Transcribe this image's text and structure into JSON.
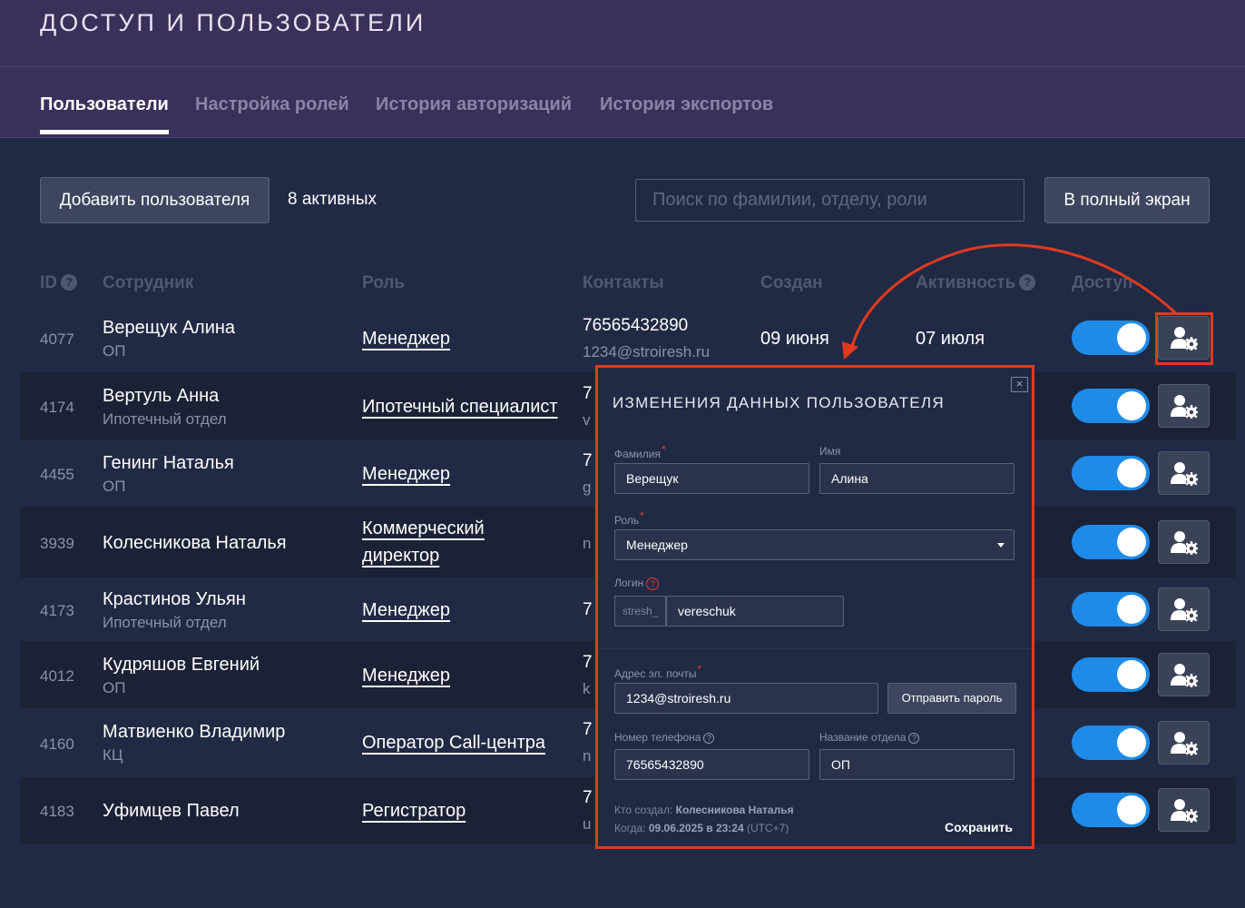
{
  "header": {
    "title": "ДОСТУП И ПОЛЬЗОВАТЕЛИ",
    "tabs": [
      {
        "label": "Пользователи",
        "active": true
      },
      {
        "label": "Настройка ролей",
        "active": false
      },
      {
        "label": "История авторизаций",
        "active": false
      },
      {
        "label": "История экспортов",
        "active": false
      }
    ]
  },
  "toolbar": {
    "add_user_label": "Добавить пользователя",
    "active_count": "8 активных",
    "search_placeholder": "Поиск по фамилии, отделу, роли",
    "fullscreen_label": "В полный экран"
  },
  "table": {
    "columns": {
      "id": "ID",
      "employee": "Сотрудник",
      "role": "Роль",
      "contacts": "Контакты",
      "created": "Создан",
      "activity": "Активность",
      "access": "Доступ"
    },
    "rows": [
      {
        "id": "4077",
        "name": "Верещук Алина",
        "dept": "ОП",
        "role": "Менеджер",
        "role2": "",
        "phone": "76565432890",
        "email": "1234@stroiresh.ru",
        "created": "09 июня",
        "activity": "07 июля",
        "access": true
      },
      {
        "id": "4174",
        "name": "Вертуль Анна",
        "dept": "Ипотечный отдел",
        "role": "Ипотечный специалист",
        "role2": "",
        "phone": "7",
        "email": "v",
        "created": "",
        "activity": "",
        "access": true
      },
      {
        "id": "4455",
        "name": "Генинг Наталья",
        "dept": "ОП",
        "role": "Менеджер",
        "role2": "",
        "phone": "7",
        "email": "g",
        "created": "",
        "activity": "",
        "access": true
      },
      {
        "id": "3939",
        "name": "Колесникова Наталья",
        "dept": "",
        "role": "Коммерческий",
        "role2": "директор",
        "phone": "",
        "email": "n",
        "created": "",
        "activity": "",
        "access": true
      },
      {
        "id": "4173",
        "name": "Крастинов Ульян",
        "dept": "Ипотечный отдел",
        "role": "Менеджер",
        "role2": "",
        "phone": "7",
        "email": "",
        "created": "",
        "activity": "",
        "access": true
      },
      {
        "id": "4012",
        "name": "Кудряшов Евгений",
        "dept": "ОП",
        "role": "Менеджер",
        "role2": "",
        "phone": "7",
        "email": "k",
        "created": "",
        "activity": "",
        "access": true
      },
      {
        "id": "4160",
        "name": "Матвиенко Владимир",
        "dept": "КЦ",
        "role": "Оператор Call-центра",
        "role2": "",
        "phone": "7",
        "email": "n",
        "created": "",
        "activity": "",
        "access": true
      },
      {
        "id": "4183",
        "name": "Уфимцев Павел",
        "dept": "",
        "role": "Регистратор",
        "role2": "",
        "phone": "7",
        "email": "u",
        "created": "",
        "activity": "",
        "access": true
      }
    ]
  },
  "modal": {
    "title": "ИЗМЕНЕНИЯ ДАННЫХ ПОЛЬЗОВАТЕЛЯ",
    "close_glyph": "×",
    "last_name_label": "Фамилия",
    "last_name_value": "Верещук",
    "first_name_label": "Имя",
    "first_name_value": "Алина",
    "role_label": "Роль",
    "role_value": "Менеджер",
    "login_label": "Логин",
    "login_prefix": "stresh_",
    "login_value": "vereschuk",
    "email_label": "Адрес эл. почты",
    "email_value": "1234@stroiresh.ru",
    "send_password_label": "Отправить пароль",
    "phone_label": "Номер телефона",
    "phone_value": "76565432890",
    "dept_label": "Название отдела",
    "dept_value": "ОП",
    "created_by_label": "Кто создал:",
    "created_by_value": "Колесникова Наталья",
    "created_when_label": "Когда:",
    "created_when_value": "09.06.2025 в 23:24",
    "timezone": "(UTC+7)",
    "save_label": "Сохранить"
  },
  "colors": {
    "background": "#212a44",
    "header": "#3b3059",
    "toggle_on": "#1e8be9",
    "highlight": "#e03a1e"
  }
}
